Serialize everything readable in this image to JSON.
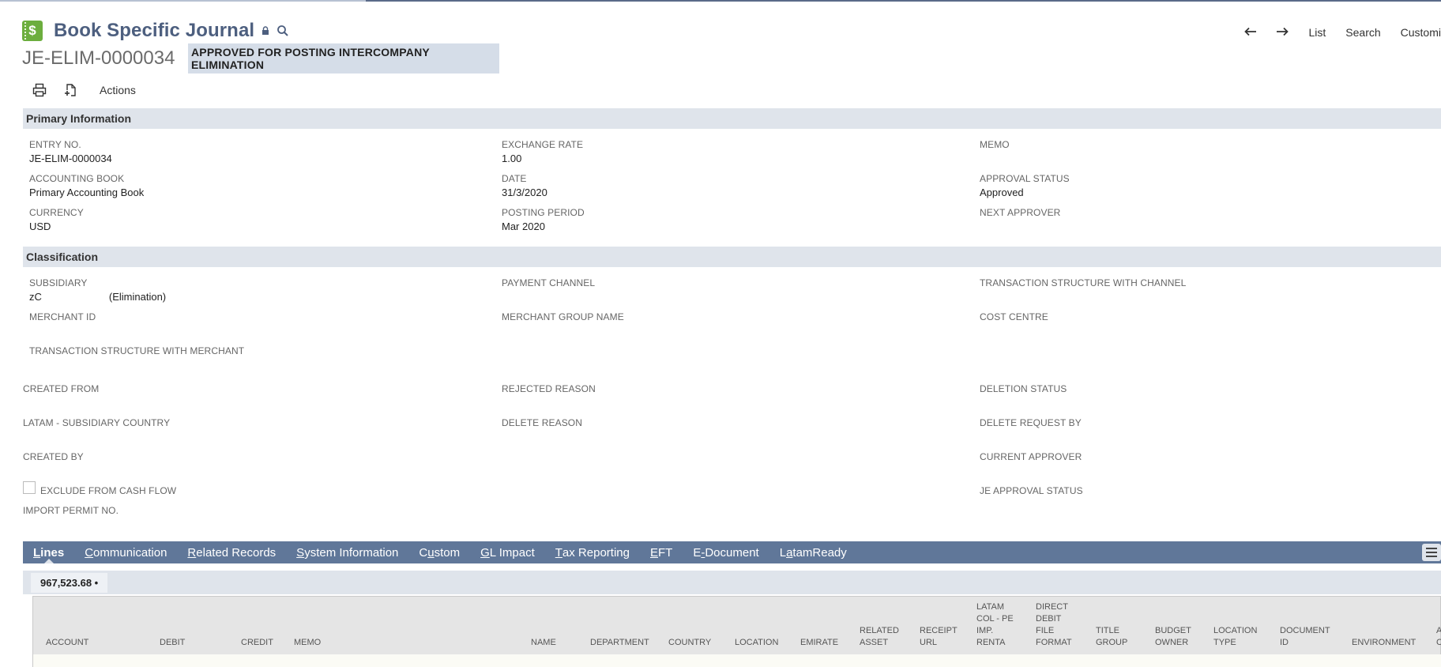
{
  "header": {
    "title": "Book Specific Journal",
    "record_id": "JE-ELIM-0000034",
    "status": "APPROVED FOR POSTING INTERCOMPANY ELIMINATION",
    "app_icon": "dollar-ledger-icon",
    "brand_color": "#6cae3e"
  },
  "topnav": {
    "list": "List",
    "search": "Search",
    "customize": "Customi"
  },
  "toolbar": {
    "actions": "Actions"
  },
  "sections": {
    "primary": "Primary Information",
    "classification": "Classification"
  },
  "primary": {
    "entry_no_label": "ENTRY NO.",
    "entry_no": "JE-ELIM-0000034",
    "exchange_rate_label": "EXCHANGE RATE",
    "exchange_rate": "1.00",
    "memo_label": "MEMO",
    "accounting_book_label": "ACCOUNTING BOOK",
    "accounting_book": "Primary Accounting Book",
    "date_label": "DATE",
    "date": "31/3/2020",
    "approval_status_label": "APPROVAL STATUS",
    "approval_status": "Approved",
    "currency_label": "CURRENCY",
    "currency": "USD",
    "posting_period_label": "POSTING PERIOD",
    "posting_period": "Mar 2020",
    "next_approver_label": "NEXT APPROVER"
  },
  "classification": {
    "subsidiary_label": "SUBSIDIARY",
    "subsidiary_prefix": "zC",
    "subsidiary_suffix": "(Elimination)",
    "payment_channel_label": "PAYMENT CHANNEL",
    "tx_structure_channel_label": "TRANSACTION STRUCTURE WITH CHANNEL",
    "merchant_id_label": "MERCHANT ID",
    "merchant_group_label": "MERCHANT GROUP NAME",
    "cost_centre_label": "COST CENTRE",
    "tx_structure_merchant_label": "TRANSACTION STRUCTURE WITH MERCHANT"
  },
  "other": {
    "created_from": "CREATED FROM",
    "rejected_reason": "REJECTED REASON",
    "deletion_status": "DELETION STATUS",
    "latam_country": "LATAM - SUBSIDIARY COUNTRY",
    "delete_reason": "DELETE REASON",
    "delete_request_by": "DELETE REQUEST BY",
    "created_by": "CREATED BY",
    "current_approver": "CURRENT APPROVER",
    "exclude_cash_flow": "EXCLUDE FROM CASH FLOW",
    "je_approval_status": "JE APPROVAL STATUS",
    "import_permit": "IMPORT PERMIT NO."
  },
  "tabs": [
    {
      "pre": "",
      "u": "L",
      "post": "ines"
    },
    {
      "pre": "",
      "u": "C",
      "post": "ommunication"
    },
    {
      "pre": "",
      "u": "R",
      "post": "elated Records"
    },
    {
      "pre": "",
      "u": "S",
      "post": "ystem Information"
    },
    {
      "pre": "C",
      "u": "u",
      "post": "stom"
    },
    {
      "pre": "",
      "u": "G",
      "post": "L Impact"
    },
    {
      "pre": "",
      "u": "T",
      "post": "ax Reporting"
    },
    {
      "pre": "",
      "u": "E",
      "post": "FT"
    },
    {
      "pre": "E",
      "u": "-",
      "post": "Document"
    },
    {
      "pre": "L",
      "u": "a",
      "post": "tamReady"
    }
  ],
  "lines": {
    "total": "967,523.68 •",
    "columns": [
      [
        "ACCOUNT"
      ],
      [
        "DEBIT"
      ],
      [
        "CREDIT"
      ],
      [
        "MEMO"
      ],
      [
        "NAME"
      ],
      [
        "DEPARTMENT"
      ],
      [
        "COUNTRY"
      ],
      [
        "LOCATION"
      ],
      [
        "EMIRATE"
      ],
      [
        "RELATED",
        "ASSET"
      ],
      [
        "RECEIPT",
        "URL"
      ],
      [
        "LATAM",
        "COL - PE",
        "IMP.",
        "RENTA"
      ],
      [
        "DIRECT",
        "DEBIT",
        "FILE",
        "FORMAT"
      ],
      [
        "TITLE",
        "GROUP"
      ],
      [
        "BUDGET",
        "OWNER"
      ],
      [
        "LOCATION",
        "TYPE"
      ],
      [
        "DOCUMENT",
        "ID"
      ],
      [
        "ENVIRONMENT"
      ],
      [
        "A",
        "C"
      ]
    ]
  }
}
